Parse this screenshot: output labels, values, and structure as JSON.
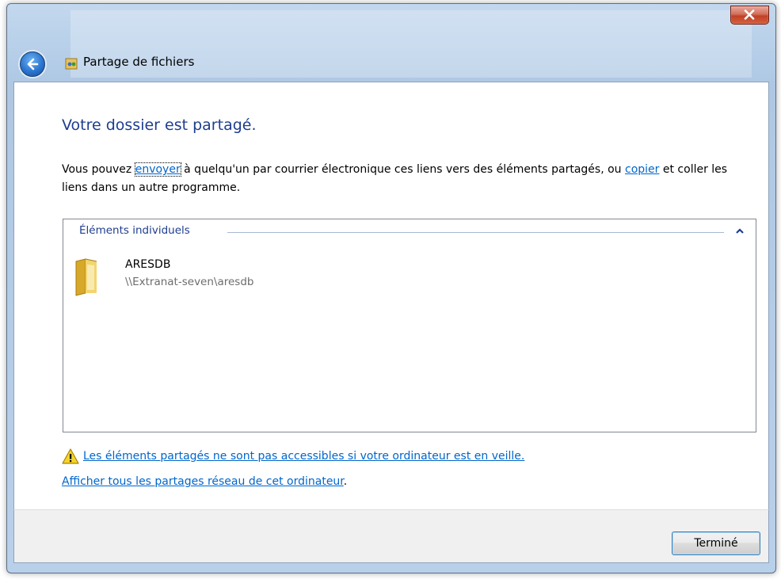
{
  "window": {
    "title": "Partage de fichiers"
  },
  "main": {
    "heading": "Votre dossier est partagé.",
    "intro": {
      "part1": "Vous pouvez ",
      "send_link": "envoyer",
      "part2": " à quelqu'un par courrier électronique ces liens vers des éléments partagés, ou ",
      "copy_link": "copier",
      "part3": " et coller les liens dans un autre programme."
    },
    "group": {
      "header": "Éléments individuels",
      "items": [
        {
          "name": "ARESDB",
          "path": "\\\\Extranat-seven\\aresdb"
        }
      ]
    },
    "warning_link": "Les éléments partagés ne sont pas accessibles si votre ordinateur est en veille.",
    "all_shares_link": "Afficher tous les partages réseau de cet ordinateur",
    "all_shares_suffix": "."
  },
  "footer": {
    "done_label": "Terminé"
  },
  "icons": {
    "back": "back-arrow-icon",
    "title": "file-sharing-icon",
    "close": "close-icon",
    "collapse": "chevron-up-icon",
    "folder": "folder-icon",
    "warning": "warning-icon"
  },
  "colors": {
    "heading": "#1e3d8f",
    "link": "#0066cc",
    "close_button": "#c24126"
  }
}
